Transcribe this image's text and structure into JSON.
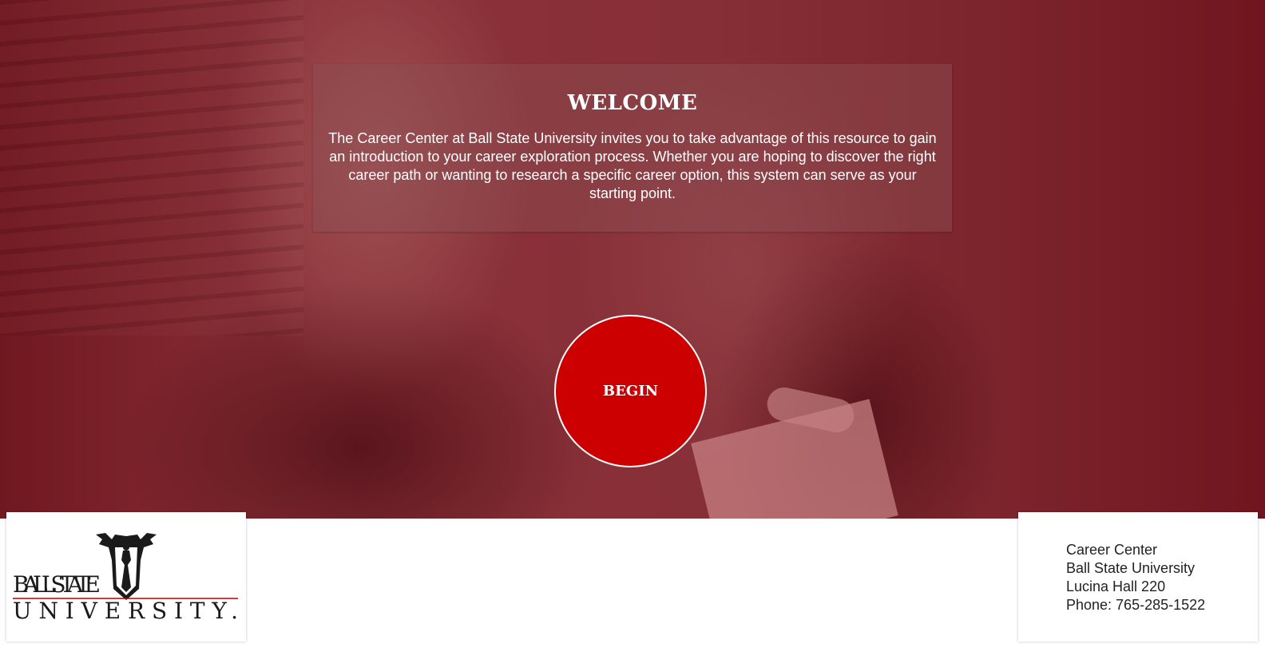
{
  "welcome": {
    "title": "WELCOME",
    "body": "The Career Center at Ball State University invites you to take advantage of this resource to gain an introduction to your career exploration process. Whether you are hoping to discover the right career path or wanting to research a specific career option, this system can serve as your starting point."
  },
  "begin_label": "BEGIN",
  "logo": {
    "line1": "BALL STATE",
    "line2": "UNIVERSITY."
  },
  "contact": {
    "line1": "Career Center",
    "line2": "Ball State University",
    "line3": "Lucina Hall 220",
    "line4": "Phone: 765-285-1522"
  },
  "colors": {
    "accent": "#cc0000",
    "hero_tint": "#8a3a42"
  }
}
